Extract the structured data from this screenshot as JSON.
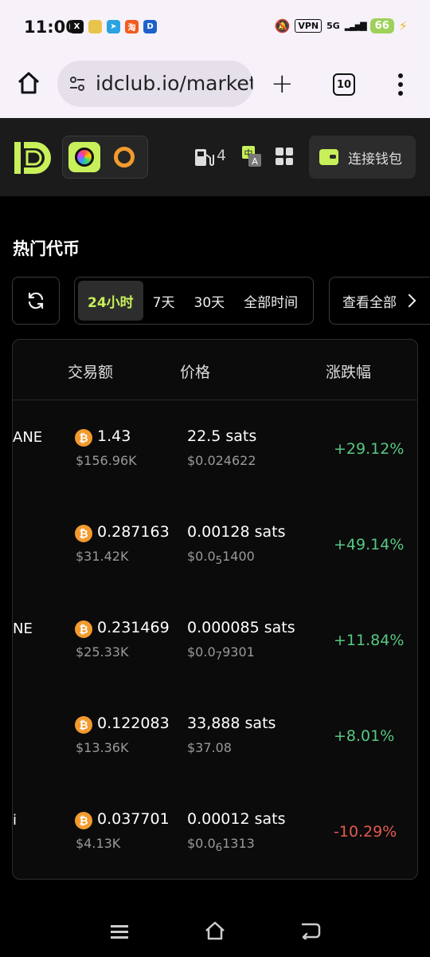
{
  "status_bar": {
    "time": "11:00",
    "vpn": "VPN",
    "network": "5G",
    "battery": "66"
  },
  "browser": {
    "url": "idclub.io/markets",
    "tab_count": "10"
  },
  "header": {
    "gas_count": "4",
    "connect_wallet": "连接钱包",
    "accent_color": "#c7f05a"
  },
  "section": {
    "title": "热门代币",
    "periods": [
      "24小时",
      "7天",
      "30天",
      "全部时间"
    ],
    "active_period": "24小时",
    "view_all": "查看全部"
  },
  "table": {
    "columns": [
      "交易额",
      "价格",
      "涨跌幅"
    ],
    "rows": [
      {
        "name": "ANE",
        "volume_btc": "1.43",
        "volume_usd": "$156.96K",
        "price_sats": "22.5 sats",
        "price_usd_prefix": "$0.024622",
        "price_usd_sub": "",
        "price_usd_suffix": "",
        "change": "+29.12%",
        "direction": "up"
      },
      {
        "name": "",
        "volume_btc": "0.287163",
        "volume_usd": "$31.42K",
        "price_sats": "0.00128 sats",
        "price_usd_prefix": "$0.0",
        "price_usd_sub": "5",
        "price_usd_suffix": "1400",
        "change": "+49.14%",
        "direction": "up"
      },
      {
        "name": "NE",
        "volume_btc": "0.231469",
        "volume_usd": "$25.33K",
        "price_sats": "0.000085 sats",
        "price_usd_prefix": "$0.0",
        "price_usd_sub": "7",
        "price_usd_suffix": "9301",
        "change": "+11.84%",
        "direction": "up"
      },
      {
        "name": "",
        "volume_btc": "0.122083",
        "volume_usd": "$13.36K",
        "price_sats": "33,888 sats",
        "price_usd_prefix": "$37.08",
        "price_usd_sub": "",
        "price_usd_suffix": "",
        "change": "+8.01%",
        "direction": "up"
      },
      {
        "name": "i",
        "volume_btc": "0.037701",
        "volume_usd": "$4.13K",
        "price_sats": "0.00012 sats",
        "price_usd_prefix": "$0.0",
        "price_usd_sub": "6",
        "price_usd_suffix": "1313",
        "change": "-10.29%",
        "direction": "down"
      }
    ]
  }
}
